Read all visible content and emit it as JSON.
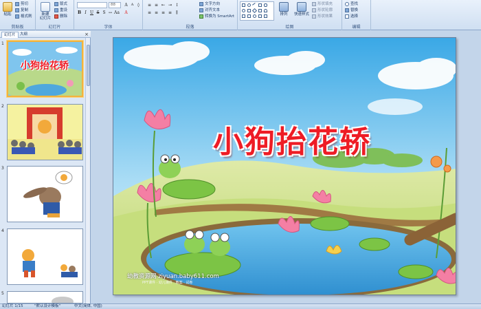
{
  "ribbon": {
    "groups": {
      "clipboard": "剪贴板",
      "slides": "幻灯片",
      "font": "字体",
      "paragraph": "段落",
      "drawing": "绘图",
      "editing": "编辑"
    },
    "paste": "粘贴",
    "cut": "剪切",
    "copy": "复制",
    "format_painter": "格式刷",
    "new_slide": "新建\n幻灯片",
    "layout": "版式",
    "reset": "重设",
    "delete": "删除",
    "font_size": "88",
    "text_direction": "文字方向",
    "align_text": "对齐文本",
    "smartart": "转换为 SmartArt",
    "arrange": "排列",
    "quick_styles": "快速样式",
    "shape_fill": "形状填充",
    "shape_outline": "形状轮廓",
    "shape_effects": "形状效果",
    "find": "查找",
    "replace": "替换",
    "select": "选择"
  },
  "pane": {
    "tab_slides": "幻灯片",
    "tab_outline": "大纲",
    "thumbs": [
      {
        "num": "1",
        "title": "小狗抬花轿"
      },
      {
        "num": "2"
      },
      {
        "num": "3"
      },
      {
        "num": "4"
      },
      {
        "num": "5"
      }
    ]
  },
  "slide": {
    "title": "小狗抬花轿",
    "watermark": "幼教资源网 ziyuan.baby611.com",
    "watermark_sub": "PPT课件 · 幼儿课件 · 教案 · 试卷"
  },
  "status": {
    "slide_count": "幻灯片 1/15",
    "theme": "\"默认设计模板\"",
    "language": "中文(简体, 中国)"
  },
  "colors": {
    "title_red": "#ee1c25",
    "ribbon_bg": "#dbe6f4",
    "selection": "#f3b33d"
  }
}
